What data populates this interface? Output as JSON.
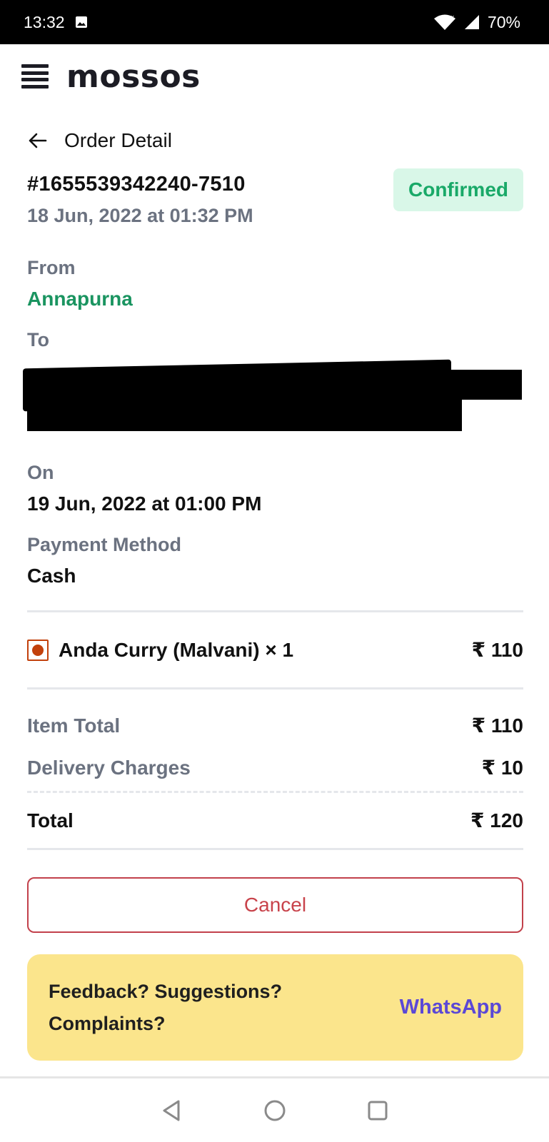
{
  "status_bar": {
    "time": "13:32",
    "battery": "70%"
  },
  "app": {
    "logo": "mossos"
  },
  "header": {
    "title": "Order Detail"
  },
  "order": {
    "id": "#1655539342240-7510",
    "placed": "18 Jun, 2022 at 01:32 PM",
    "status": "Confirmed"
  },
  "from": {
    "label": "From",
    "value": "Annapurna"
  },
  "to": {
    "label": "To"
  },
  "on": {
    "label": "On",
    "value": "19 Jun, 2022 at 01:00 PM"
  },
  "payment": {
    "label": "Payment Method",
    "value": "Cash"
  },
  "items": [
    {
      "name": "Anda Curry (Malvani) × 1",
      "price": "₹ 110"
    }
  ],
  "summary": {
    "item_total_label": "Item Total",
    "item_total": "₹ 110",
    "delivery_label": "Delivery Charges",
    "delivery": "₹ 10",
    "total_label": "Total",
    "total": "₹ 120"
  },
  "actions": {
    "cancel_label": "Cancel"
  },
  "feedback": {
    "line1": "Feedback? Suggestions?",
    "line2": "Complaints?",
    "link": "WhatsApp"
  },
  "colors": {
    "confirmed_bg": "#d9f7e8",
    "confirmed_text": "#19a968",
    "restaurant_green": "#1a9460",
    "cancel_red": "#c8434b",
    "feedback_bg": "#fbe58c",
    "whatsapp_link": "#5b48d6"
  }
}
